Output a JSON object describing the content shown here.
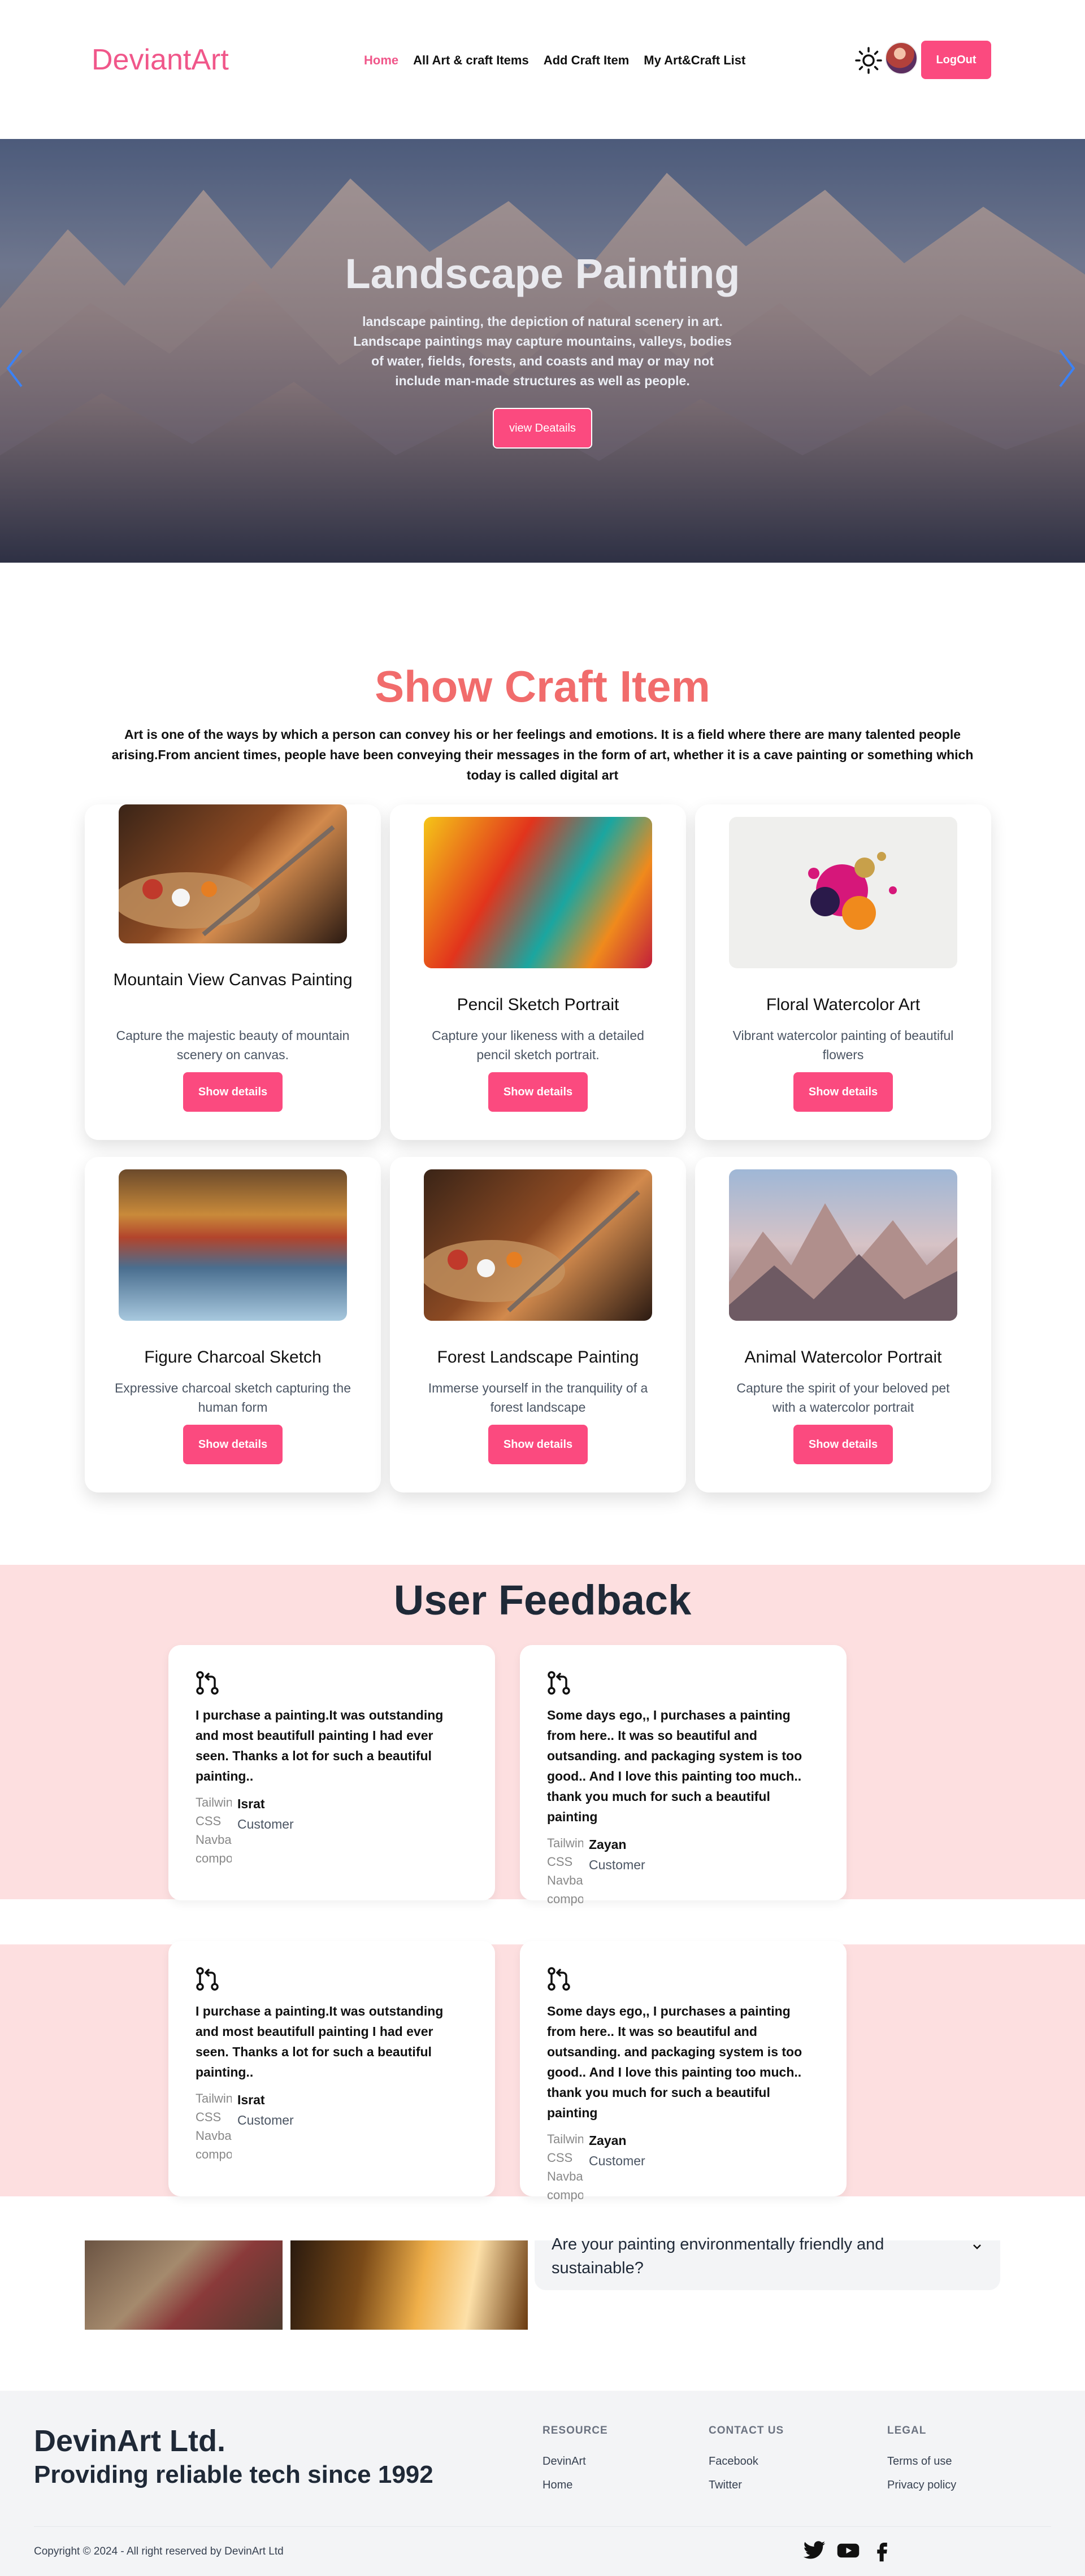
{
  "nav": {
    "logo": "DeviantArt",
    "links": [
      "Home",
      "All Art & craft Items",
      "Add Craft Item",
      "My Art&Craft List"
    ],
    "logout_label": "LogOut"
  },
  "hero": {
    "title": "Landscape Painting",
    "text": "landscape painting, the depiction of natural scenery in art. Landscape paintings may capture mountains, valleys, bodies of water, fields, forests, and coasts and may or may not include man-made structures as well as people.",
    "button_label": "view Deatails"
  },
  "crafts": {
    "title": "Show Craft Item",
    "description": "Art is one of the ways by which a person can convey his or her feelings and emotions. It is a field where there are many talented people arising.From ancient times, people have been conveying their messages in the form of art, whether it is a cave painting or something which today is called digital art",
    "button_label": "Show details",
    "items": [
      {
        "title": "Mountain View Canvas Painting",
        "description": "Capture the majestic beauty of mountain scenery on canvas."
      },
      {
        "title": "Pencil Sketch Portrait",
        "description": "Capture your likeness with a detailed pencil sketch portrait."
      },
      {
        "title": "Floral Watercolor Art",
        "description": "Vibrant watercolor painting of beautiful flowers"
      },
      {
        "title": "Figure Charcoal Sketch",
        "description": "Expressive charcoal sketch capturing the human form"
      },
      {
        "title": "Forest Landscape Painting",
        "description": "Immerse yourself in the tranquility of a forest landscape"
      },
      {
        "title": "Animal Watercolor Portrait",
        "description": "Capture the spirit of your beloved pet with a watercolor portrait"
      }
    ]
  },
  "feedback": {
    "title": "User Feedback",
    "alt_text": "Tailwind CSS Navbar component",
    "items": [
      {
        "text": "I purchase a painting.It was outstanding and most beautifull painting I had ever seen. Thanks a lot for such a beautiful painting..",
        "name": "Israt",
        "role": "Customer"
      },
      {
        "text": "Some days ego,, I purchases a painting from here.. It was so beautiful and outsanding. and packaging system is too good.. And I love this painting too much.. thank you much for such a beautiful painting",
        "name": "Zayan",
        "role": "Customer"
      },
      {
        "text": "I purchase a painting.It was outstanding and most beautifull painting I had ever seen. Thanks a lot for such a beautiful painting..",
        "name": "Israt",
        "role": "Customer"
      },
      {
        "text": "Some days ego,, I purchases a painting from here.. It was so beautiful and outsanding. and packaging system is too good.. And I love this painting too much.. thank you much for such a beautiful painting",
        "name": "Zayan",
        "role": "Customer"
      }
    ]
  },
  "faq": {
    "question": "Are your painting environmentally friendly and sustainable?"
  },
  "footer": {
    "company": "DevinArt Ltd.",
    "tagline": "Providing reliable tech since 1992",
    "columns": [
      {
        "heading": "RESOURCE",
        "links": [
          "DevinArt",
          "Home"
        ]
      },
      {
        "heading": "CONTACT US",
        "links": [
          "Facebook",
          "Twitter"
        ]
      },
      {
        "heading": "LEGAL",
        "links": [
          "Terms of use",
          "Privacy policy"
        ]
      }
    ],
    "copyright": "Copyright © 2024 - All right reserved by DevinArt Ltd"
  },
  "colors": {
    "brand_pink": "#fb4a7f",
    "logo_pink": "#f0578a",
    "section_title": "#f16c6c",
    "feedback_band": "#fddfe0",
    "footer_bg": "#f3f4f6"
  },
  "icons": {
    "theme_toggle": "sun-icon",
    "carousel_prev": "chevron-left-icon",
    "carousel_next": "chevron-right-icon",
    "feedback": "git-pull-request-icon",
    "faq_toggle": "chevron-down-icon",
    "social": [
      "twitter-icon",
      "youtube-icon",
      "facebook-icon"
    ]
  }
}
